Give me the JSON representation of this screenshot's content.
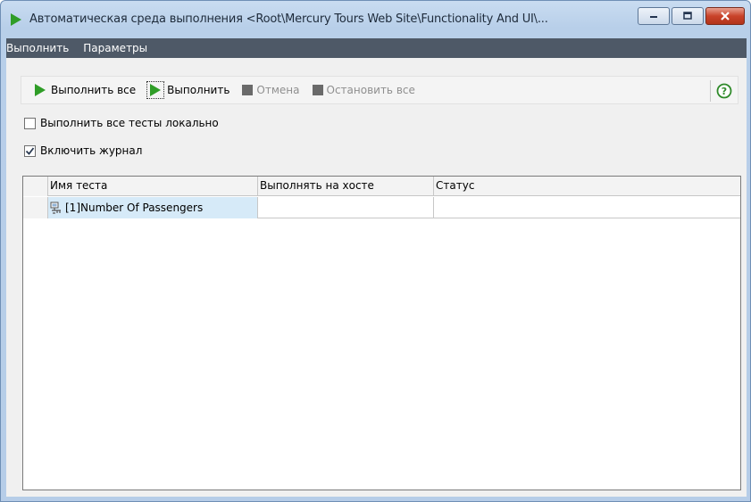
{
  "window": {
    "title": "Автоматическая среда выполнения <Root\\Mercury Tours Web Site\\Functionality And UI\\...",
    "accent_color": "#2f9d27",
    "title_icon": "green-play-icon",
    "caption_buttons": [
      "minimize-icon",
      "maximize-icon",
      "close-icon"
    ]
  },
  "menu": {
    "run": "Выполнить",
    "params": "Параметры"
  },
  "toolbar": {
    "run_all": "Выполнить все",
    "run": "Выполнить",
    "cancel": "Отмена",
    "stop_all": "Остановить все",
    "help_icon": "help-icon"
  },
  "options": {
    "run_local": {
      "label": "Выполнить все тесты локально",
      "checked": false
    },
    "enable_log": {
      "label": "Включить журнал",
      "checked": true
    }
  },
  "grid": {
    "columns": [
      "Имя теста",
      "Выполнять на хосте",
      "Статус"
    ],
    "rows": [
      {
        "test_name": "[1]Number Of Passengers",
        "host": "",
        "status": "",
        "icon": "test-icon"
      }
    ]
  }
}
